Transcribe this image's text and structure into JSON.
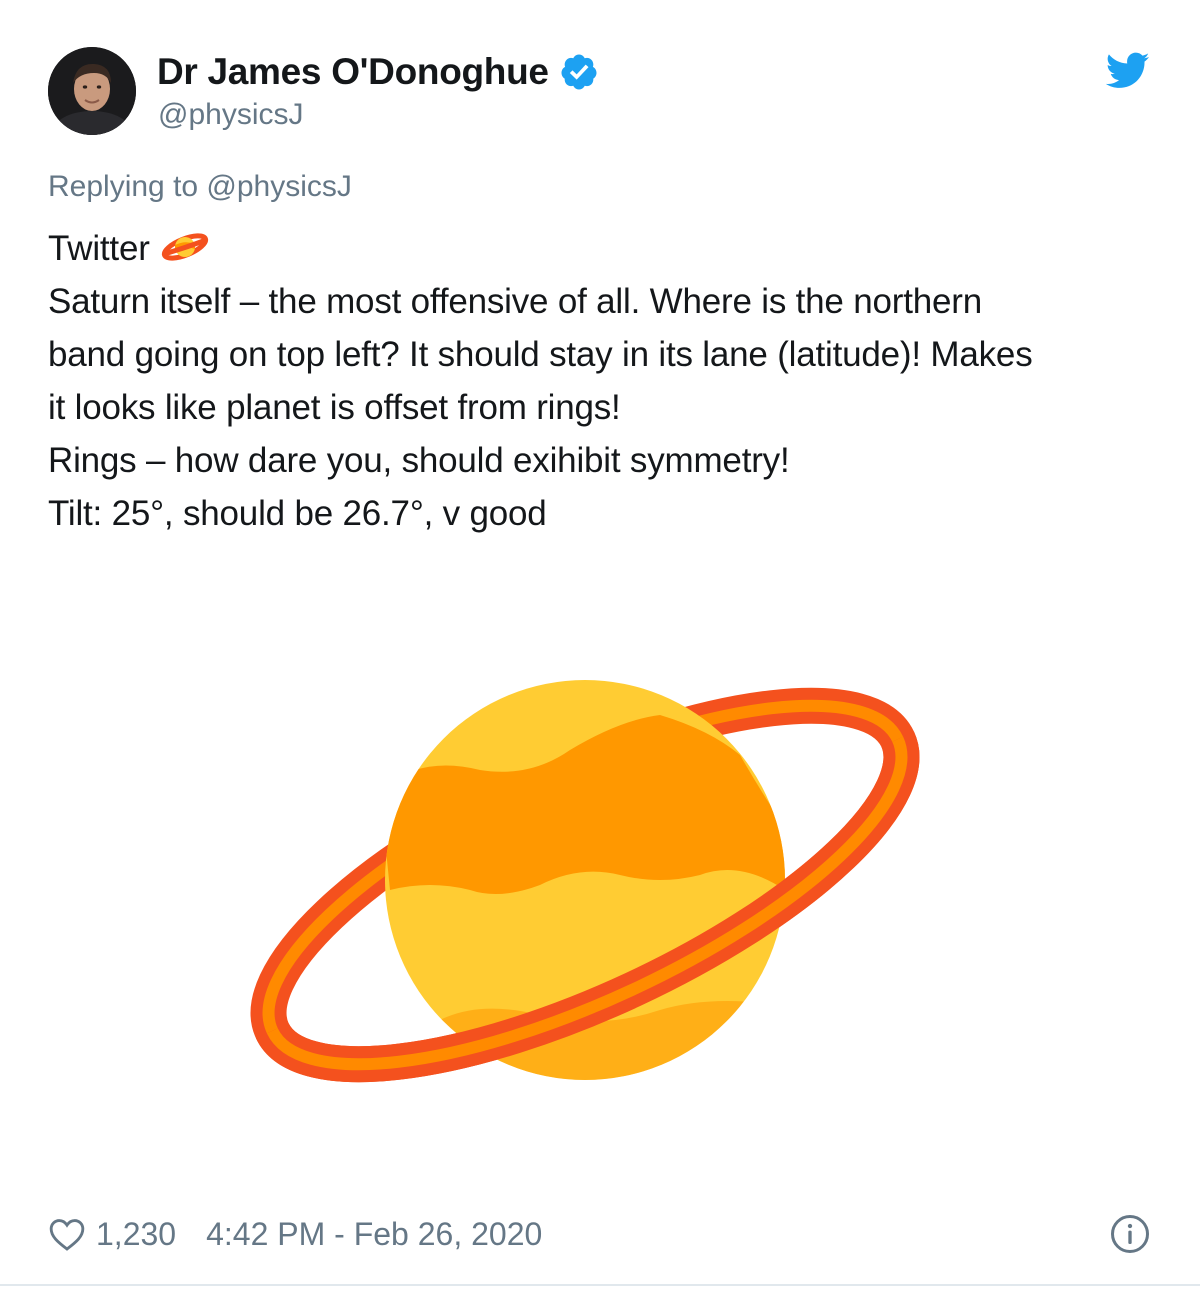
{
  "author": {
    "display_name": "Dr James O'Donoghue",
    "handle": "@physicsJ",
    "verified": true
  },
  "reply": {
    "text": "Replying to @physicsJ"
  },
  "tweet": {
    "lines": [
      "Twitter",
      "Saturn itself – the most offensive of all. Where is the northern",
      "band going on top left? It should stay in its lane (latitude)! Makes",
      "it looks like planet is offset from rings!",
      "Rings –  how dare you, should exihibit symmetry!",
      "Tilt: 25°, should be 26.7°, v good"
    ],
    "inline_emoji": "ringed-planet-icon"
  },
  "media": {
    "image": "ringed-planet-illustration"
  },
  "footer": {
    "like_count": "1,230",
    "timestamp": "4:42 PM - Feb 26, 2020"
  },
  "icons": {
    "brand": "twitter-bird-icon",
    "verified": "verified-badge-icon",
    "like": "heart-icon",
    "info": "info-icon"
  },
  "colors": {
    "twitter_blue": "#1da1f2",
    "secondary_text": "#657786",
    "primary_text": "#14171a",
    "ring_red": "#f4511e",
    "ring_orange": "#ff8a00",
    "planet_yellow": "#ffcc33",
    "planet_band": "#ff9800"
  }
}
